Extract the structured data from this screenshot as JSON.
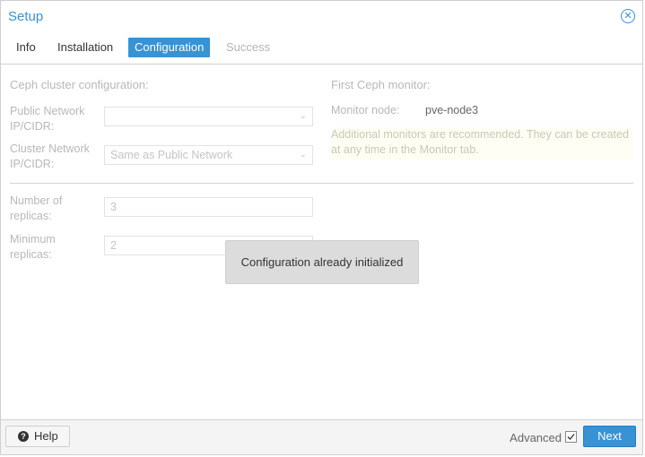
{
  "window": {
    "title": "Setup",
    "close_glyph": "✕",
    "close_icon": "close-circle-icon"
  },
  "tabs": [
    {
      "label": "Info",
      "state": "normal"
    },
    {
      "label": "Installation",
      "state": "normal"
    },
    {
      "label": "Configuration",
      "state": "active"
    },
    {
      "label": "Success",
      "state": "disabled"
    }
  ],
  "left_section": {
    "heading": "Ceph cluster configuration:",
    "public_network": {
      "label": "Public Network IP/CIDR:",
      "value": ""
    },
    "cluster_network": {
      "label": "Cluster Network IP/CIDR:",
      "value": "Same as Public Network"
    },
    "replicas": {
      "label": "Number of replicas:",
      "value": "3"
    },
    "min_replicas": {
      "label": "Minimum replicas:",
      "value": "2"
    }
  },
  "right_section": {
    "heading": "First Ceph monitor:",
    "monitor_node_label": "Monitor node:",
    "monitor_node_value": "pve-node3",
    "hint": "Additional monitors are recommended. They can be created at any time in the Monitor tab."
  },
  "toast": {
    "message": "Configuration already initialized"
  },
  "footer": {
    "help_label": "Help",
    "help_icon": "question-circle-icon",
    "advanced_label": "Advanced",
    "advanced_checked": true,
    "next_label": "Next"
  },
  "colors": {
    "accent": "#3892d4",
    "disabled_text": "#b8b8b8",
    "hint_background": "#fefef4",
    "toast_background": "#dcdcdc"
  }
}
